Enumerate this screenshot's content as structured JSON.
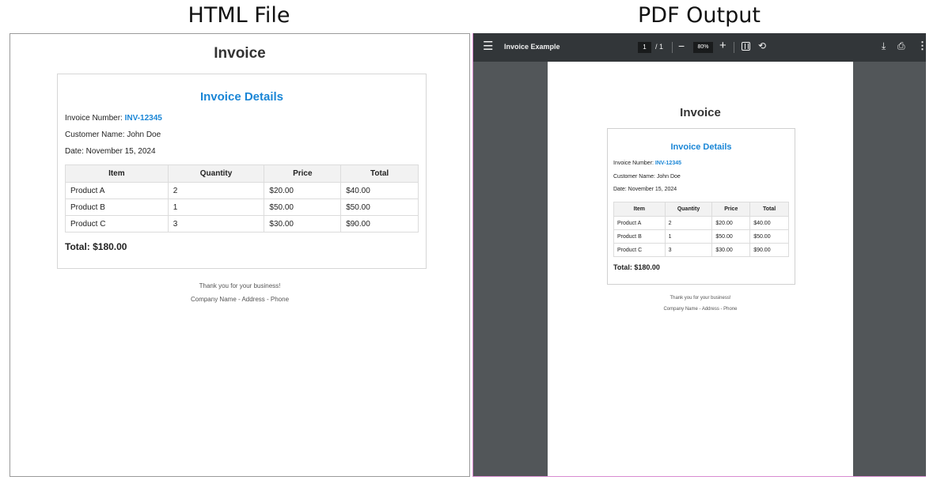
{
  "headings": {
    "left": "HTML File",
    "right": "PDF Output"
  },
  "invoice": {
    "title": "Invoice",
    "details_title": "Invoice Details",
    "invoice_number_label": "Invoice Number: ",
    "invoice_number": "INV-12345",
    "customer_name": "Customer Name: John Doe",
    "date": "Date: November 15, 2024",
    "columns": [
      "Item",
      "Quantity",
      "Price",
      "Total"
    ],
    "rows": [
      [
        "Product A",
        "2",
        "$20.00",
        "$40.00"
      ],
      [
        "Product B",
        "1",
        "$50.00",
        "$50.00"
      ],
      [
        "Product C",
        "3",
        "$30.00",
        "$90.00"
      ]
    ],
    "total": "Total: $180.00",
    "footer_thanks": "Thank you for your business!",
    "footer_company": "Company Name - Address - Phone"
  },
  "viewer": {
    "title": "Invoice Example",
    "page": "1",
    "page_of": "/  1",
    "zoom": "80%",
    "icons": [
      "menu-icon",
      "zoom-out-icon",
      "zoom-in-icon",
      "fit-page-icon",
      "rotate-icon",
      "download-icon",
      "print-icon",
      "more-icon"
    ]
  },
  "colors": {
    "accent": "#1a86d6",
    "viewer_bg": "#525659",
    "toolbar_bg": "#323639"
  }
}
